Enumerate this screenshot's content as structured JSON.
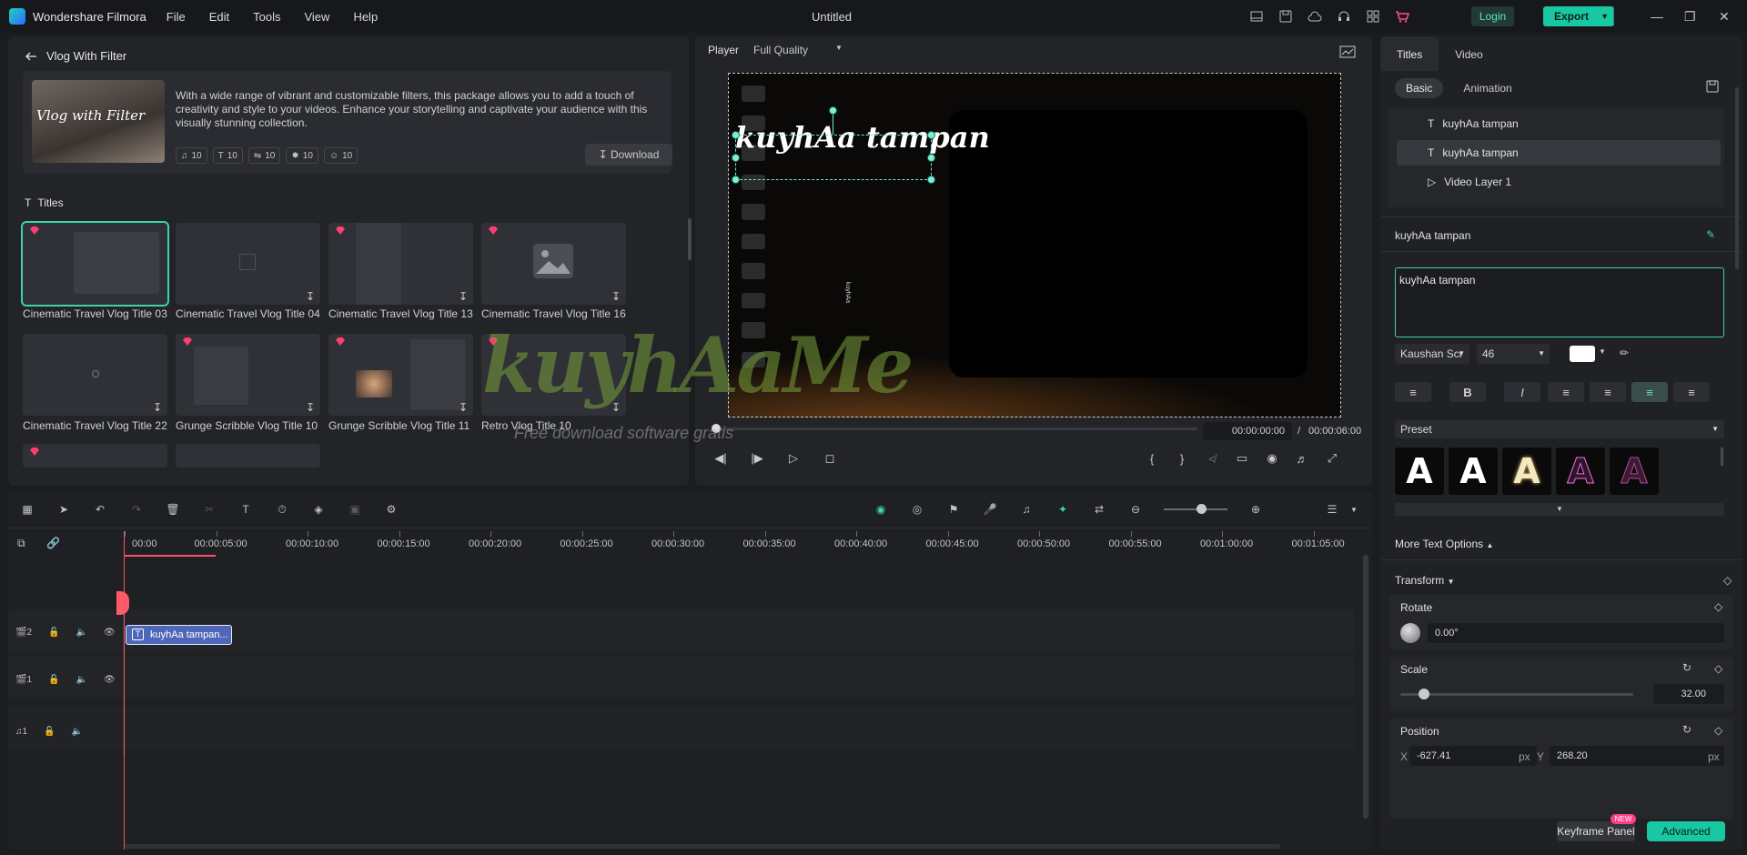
{
  "app": {
    "name": "Wondershare Filmora",
    "title": "Untitled"
  },
  "menu": [
    "File",
    "Edit",
    "Tools",
    "View",
    "Help"
  ],
  "header": {
    "login": "Login",
    "export": "Export"
  },
  "library": {
    "back_title": "Vlog With Filter",
    "pack": {
      "thumb_text": "Vlog with Filter",
      "description": "With a wide range of vibrant and customizable filters, this package allows you to add a touch of creativity and style to your videos. Enhance your storytelling and captivate your audience with this visually stunning collection.",
      "counts": [
        "10",
        "10",
        "10",
        "10",
        "10"
      ],
      "download": "Download"
    },
    "section": "Titles",
    "tiles": [
      {
        "label": "Cinematic Travel Vlog Title 03"
      },
      {
        "label": "Cinematic Travel Vlog Title 04"
      },
      {
        "label": "Cinematic Travel Vlog Title 13"
      },
      {
        "label": "Cinematic Travel Vlog Title 16"
      },
      {
        "label": "Cinematic Travel Vlog Title 22"
      },
      {
        "label": "Grunge Scribble Vlog Title 10"
      },
      {
        "label": "Grunge Scribble Vlog Title 11"
      },
      {
        "label": "Retro Vlog Title 10"
      }
    ]
  },
  "player": {
    "label": "Player",
    "quality": "Full Quality",
    "title_text": "kuyhAa tampan",
    "small_text": "kuyhAa",
    "current_time": "00:00:00:00",
    "separator": "/",
    "total_time": "00:00:06:00"
  },
  "watermark": {
    "logo": "kuyhAaMe",
    "tagline": "Free download software gratis"
  },
  "props": {
    "tabs": [
      "Titles",
      "Video"
    ],
    "subtabs": [
      "Basic",
      "Animation"
    ],
    "layers": [
      "kuyhAa tampan",
      "kuyhAa tampan",
      "Video Layer 1"
    ],
    "name": "kuyhAa tampan",
    "text_value": "kuyhAa tampan",
    "font": "Kaushan Scr",
    "size": "46",
    "preset_label": "Preset",
    "more_text_options": "More Text Options",
    "transform": "Transform",
    "rotate_label": "Rotate",
    "rotate_value": "0.00°",
    "scale_label": "Scale",
    "scale_value": "32.00",
    "scale_fraction": 0.1,
    "position_label": "Position",
    "x_label": "X",
    "x_value": "-627.41",
    "y_label": "Y",
    "y_value": "268.20",
    "unit": "px",
    "keyframe_panel": "Keyframe Panel",
    "new_tag": "NEW",
    "advanced": "Advanced"
  },
  "timeline": {
    "ticks": [
      "00:00",
      "00:00:05:00",
      "00:00:10:00",
      "00:00:15:00",
      "00:00:20:00",
      "00:00:25:00",
      "00:00:30:00",
      "00:00:35:00",
      "00:00:40:00",
      "00:00:45:00",
      "00:00:50:00",
      "00:00:55:00",
      "00:01:00:00",
      "00:01:05:00"
    ],
    "clip_label": "kuyhAa tampan...",
    "track_numbers": [
      "2",
      "1",
      "1"
    ]
  },
  "colors": {
    "accent": "#18c8a3",
    "bg": "#1b1c1f",
    "panel": "#232428",
    "clip": "#4f67b9",
    "playhead": "#ff4f66"
  }
}
